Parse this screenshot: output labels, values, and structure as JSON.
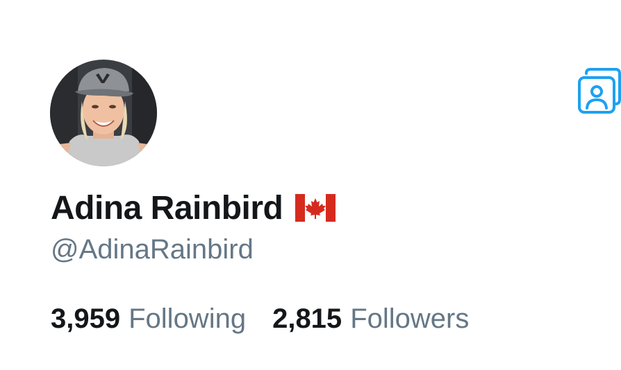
{
  "profile": {
    "display_name": "Adina Rainbird",
    "flag_icon": "canada-flag-icon",
    "handle": "@AdinaRainbird",
    "avatar_icon": "user-avatar-photo",
    "switch_icon": "switch-profile-icon"
  },
  "stats": {
    "following_count": "3,959",
    "following_label": "Following",
    "followers_count": "2,815",
    "followers_label": "Followers"
  },
  "colors": {
    "text_primary": "#14171a",
    "text_secondary": "#657786",
    "accent": "#1da1f2",
    "flag_red": "#d52b1e"
  }
}
